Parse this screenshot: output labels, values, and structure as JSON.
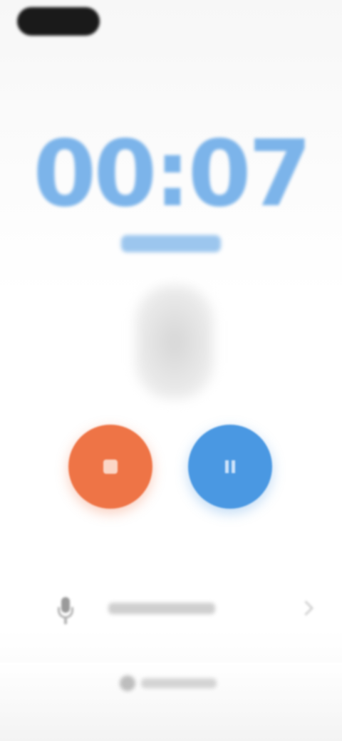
{
  "timer": {
    "display": "00:07"
  },
  "colors": {
    "timer": "#7cb4ea",
    "stop_button": "#ee7446",
    "pause_button": "#4a98e2",
    "background": "#ffffff"
  },
  "controls": {
    "stop_icon": "stop-icon",
    "pause_icon": "pause-icon"
  },
  "recording_row": {
    "icon": "microphone-icon",
    "chevron_icon": "chevron-right-icon"
  },
  "footer": {
    "icon": "footer-icon"
  }
}
